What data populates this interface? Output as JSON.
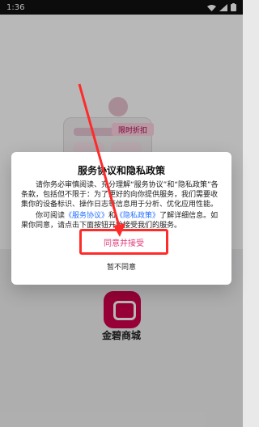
{
  "status_bar": {
    "time": "1:36",
    "icons": [
      "wifi-icon",
      "signal-icon",
      "battery-icon"
    ]
  },
  "hero": {
    "badge": "限时折扣"
  },
  "dialog": {
    "title": "服务协议和隐私政策",
    "paragraph1": "请你务必审慎阅读、充分理解“服务协议”和“隐私政策”各条款，包括但不限于：为了更好的向你提供服务，我们需要收集你的设备标识、操作日志等信息用于分析、优化应用性能。",
    "paragraph2_prefix": "你可阅读",
    "link_service": "《服务协议》",
    "paragraph2_middle": "和",
    "link_privacy": "《隐私政策》",
    "paragraph2_suffix": "了解详细信息。如果你同意，请点击下面按钮开始接受我们的服务。",
    "agree_label": "同意并接受",
    "disagree_label": "暂不同意"
  },
  "app": {
    "name": "金碧商城"
  },
  "colors": {
    "accent": "#e03b78",
    "annotation_red": "#ff2a2a",
    "brand": "#d1004b"
  }
}
